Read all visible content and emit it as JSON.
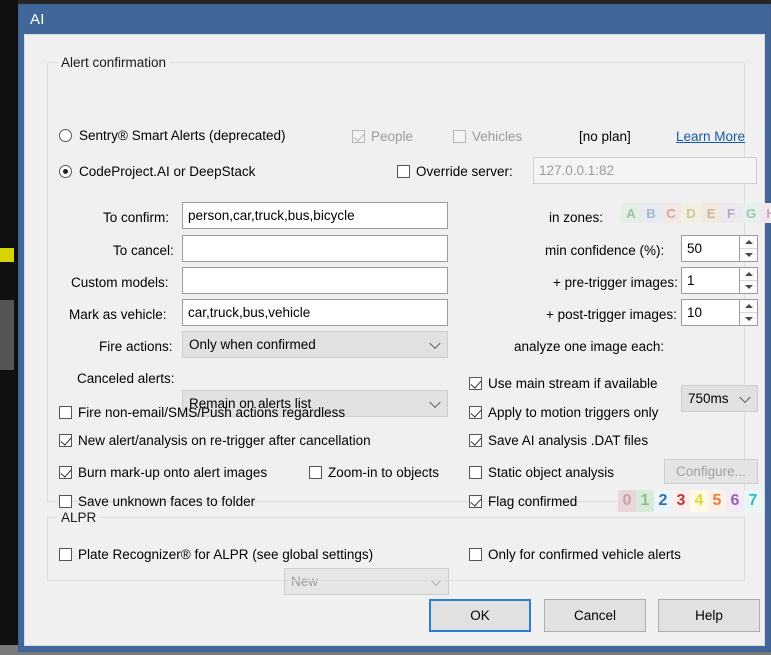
{
  "window": {
    "title": "AI"
  },
  "groups": {
    "alert": {
      "legend": "Alert confirmation"
    },
    "alpr": {
      "legend": "ALPR"
    }
  },
  "engine": {
    "sentry": {
      "label": "Sentry® Smart Alerts (deprecated)",
      "selected": false
    },
    "codeproject": {
      "label": "CodeProject.AI or DeepStack",
      "selected": true
    },
    "people": {
      "label": "People",
      "checked": true,
      "disabled": true
    },
    "vehicles": {
      "label": "Vehicles",
      "checked": false,
      "disabled": true
    },
    "plan": "[no plan]",
    "learn_more": "Learn More",
    "override_server": {
      "label": "Override server:",
      "checked": false
    },
    "server_address": "127.0.0.1:82"
  },
  "fields": {
    "to_confirm": {
      "label": "To confirm:",
      "value": "person,car,truck,bus,bicycle"
    },
    "to_cancel": {
      "label": "To cancel:",
      "value": ""
    },
    "custom_models": {
      "label": "Custom models:",
      "value": ""
    },
    "mark_as_vehicle": {
      "label": "Mark as vehicle:",
      "value": "car,truck,bus,vehicle"
    },
    "fire_actions": {
      "label": "Fire actions:",
      "value": "Only when confirmed"
    },
    "canceled_alerts": {
      "label": "Canceled alerts:",
      "value": "Remain on alerts list"
    }
  },
  "right_fields": {
    "in_zones": {
      "label": "in zones:",
      "zones": [
        "A",
        "B",
        "C",
        "D",
        "E",
        "F",
        "G",
        "H"
      ],
      "disabled": true
    },
    "min_confidence": {
      "label": "min confidence (%):",
      "value": "50"
    },
    "pre_trigger": {
      "label": "+ pre-trigger images:",
      "value": "1"
    },
    "post_trigger": {
      "label": "+ post-trigger images:",
      "value": "10"
    },
    "analyze_each": {
      "label": "analyze one image each:",
      "value": "750ms"
    }
  },
  "left_checks": {
    "fire_regardless": {
      "label": "Fire non-email/SMS/Push actions regardless",
      "checked": false
    },
    "new_alert_retrigger": {
      "label": "New alert/analysis on re-trigger after cancellation",
      "checked": true
    },
    "burn_markup": {
      "label": "Burn mark-up onto alert images",
      "checked": true
    },
    "zoom_in_objects": {
      "label": "Zoom-in to objects",
      "checked": false
    },
    "save_unknown_faces": {
      "label": "Save unknown faces to folder",
      "checked": false
    },
    "faces_folder": {
      "value": "New",
      "disabled": true
    }
  },
  "right_checks": {
    "use_main_stream": {
      "label": "Use main stream if available",
      "checked": true
    },
    "apply_motion": {
      "label": "Apply to motion triggers only",
      "checked": true
    },
    "save_dat": {
      "label": "Save AI analysis .DAT files",
      "checked": true
    },
    "static_object": {
      "label": "Static object analysis",
      "checked": false
    },
    "configure_button": {
      "label": "Configure...",
      "disabled": true
    },
    "flag_confirmed": {
      "label": "Flag confirmed",
      "checked": true
    },
    "flags": [
      {
        "digit": "0",
        "color": "#c9a0a8",
        "bg": "#e9d6da"
      },
      {
        "digit": "1",
        "color": "#8fbe8f",
        "bg": "#d8ead8"
      },
      {
        "digit": "2",
        "color": "#2a6fb0",
        "bg": "#ecf3fa"
      },
      {
        "digit": "3",
        "color": "#cc3333",
        "bg": "#fbeeee"
      },
      {
        "digit": "4",
        "color": "#e8d43a",
        "bg": "#fdfbe6"
      },
      {
        "digit": "5",
        "color": "#e8803a",
        "bg": "#fdf1e8"
      },
      {
        "digit": "6",
        "color": "#9a5fb5",
        "bg": "#f3ecf7"
      },
      {
        "digit": "7",
        "color": "#2fbfb8",
        "bg": "#e9f8f7"
      }
    ]
  },
  "alpr": {
    "plate_recognizer": {
      "label": "Plate Recognizer® for ALPR (see global settings)",
      "checked": false
    },
    "only_confirmed": {
      "label": "Only for confirmed vehicle alerts",
      "checked": false
    }
  },
  "buttons": {
    "ok": "OK",
    "cancel": "Cancel",
    "help": "Help"
  }
}
